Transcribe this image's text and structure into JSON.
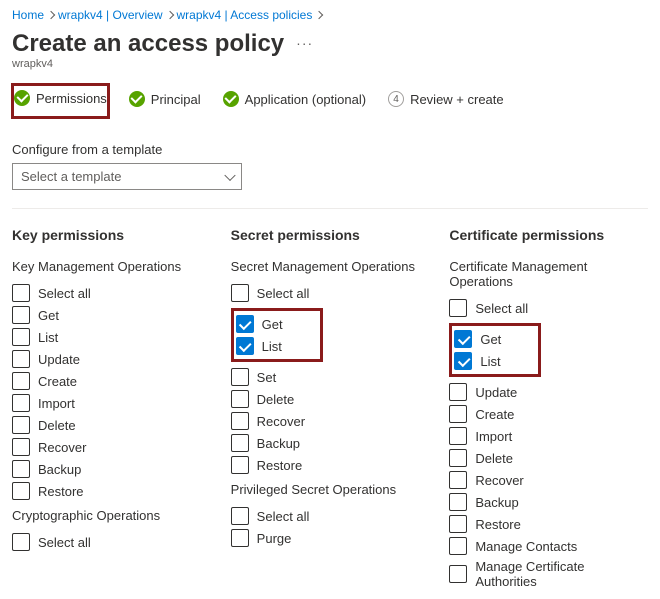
{
  "breadcrumb": {
    "items": [
      {
        "label": "Home"
      },
      {
        "label": "wrapkv4 | Overview"
      },
      {
        "label": "wrapkv4 | Access policies"
      }
    ]
  },
  "header": {
    "title": "Create an access policy",
    "subtitle": "wrapkv4"
  },
  "steps": [
    {
      "label": "Permissions",
      "state": "done",
      "active": true,
      "highlight": true
    },
    {
      "label": "Principal",
      "state": "done",
      "active": false
    },
    {
      "label": "Application (optional)",
      "state": "done",
      "active": false
    },
    {
      "label": "Review + create",
      "state": "num",
      "num": "4",
      "active": false
    }
  ],
  "template": {
    "label": "Configure from a template",
    "placeholder": "Select a template"
  },
  "columns": [
    {
      "title": "Key permissions",
      "groups": [
        {
          "title": "Key Management Operations",
          "select_all": "Select all",
          "highlight": false,
          "items": [
            {
              "label": "Get",
              "checked": false
            },
            {
              "label": "List",
              "checked": false
            },
            {
              "label": "Update",
              "checked": false
            },
            {
              "label": "Create",
              "checked": false
            },
            {
              "label": "Import",
              "checked": false
            },
            {
              "label": "Delete",
              "checked": false
            },
            {
              "label": "Recover",
              "checked": false
            },
            {
              "label": "Backup",
              "checked": false
            },
            {
              "label": "Restore",
              "checked": false
            }
          ]
        },
        {
          "title": "Cryptographic Operations",
          "select_all": "Select all",
          "items": []
        }
      ]
    },
    {
      "title": "Secret permissions",
      "groups": [
        {
          "title": "Secret Management Operations",
          "select_all": "Select all",
          "highlight": true,
          "items": [
            {
              "label": "Get",
              "checked": true
            },
            {
              "label": "List",
              "checked": true
            },
            {
              "label": "Set",
              "checked": false
            },
            {
              "label": "Delete",
              "checked": false
            },
            {
              "label": "Recover",
              "checked": false
            },
            {
              "label": "Backup",
              "checked": false
            },
            {
              "label": "Restore",
              "checked": false
            }
          ]
        },
        {
          "title": "Privileged Secret Operations",
          "select_all": "Select all",
          "items": [
            {
              "label": "Purge",
              "checked": false
            }
          ]
        }
      ]
    },
    {
      "title": "Certificate permissions",
      "groups": [
        {
          "title": "Certificate Management Operations",
          "select_all": "Select all",
          "highlight": true,
          "items": [
            {
              "label": "Get",
              "checked": true
            },
            {
              "label": "List",
              "checked": true
            },
            {
              "label": "Update",
              "checked": false
            },
            {
              "label": "Create",
              "checked": false
            },
            {
              "label": "Import",
              "checked": false
            },
            {
              "label": "Delete",
              "checked": false
            },
            {
              "label": "Recover",
              "checked": false
            },
            {
              "label": "Backup",
              "checked": false
            },
            {
              "label": "Restore",
              "checked": false
            },
            {
              "label": "Manage Contacts",
              "checked": false
            },
            {
              "label": "Manage Certificate Authorities",
              "checked": false
            }
          ]
        }
      ]
    }
  ]
}
